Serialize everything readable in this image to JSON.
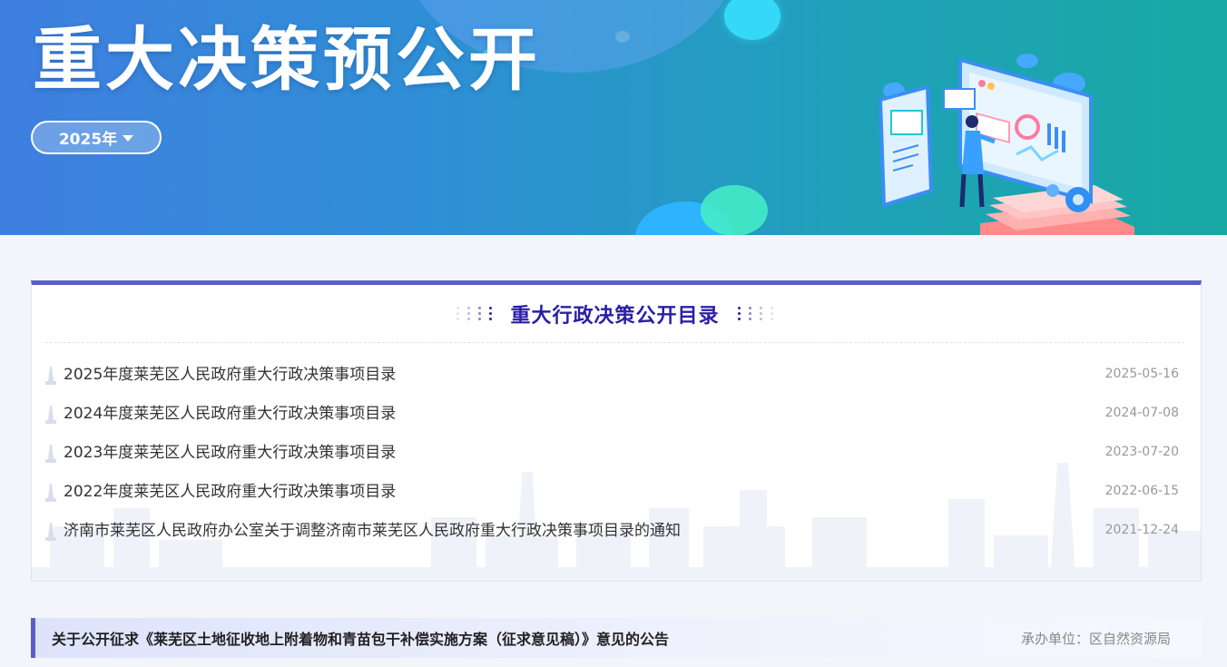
{
  "banner": {
    "title": "重大决策预公开",
    "year_select": "2025年"
  },
  "catalog": {
    "title": "重大行政决策公开目录",
    "items": [
      {
        "title": "2025年度莱芜区人民政府重大行政决策事项目录",
        "date": "2025-05-16"
      },
      {
        "title": "2024年度莱芜区人民政府重大行政决策事项目录",
        "date": "2024-07-08"
      },
      {
        "title": "2023年度莱芜区人民政府重大行政决策事项目录",
        "date": "2023-07-20"
      },
      {
        "title": "2022年度莱芜区人民政府重大行政决策事项目录",
        "date": "2022-06-15"
      },
      {
        "title": "济南市莱芜区人民政府办公室关于调整济南市莱芜区人民政府重大行政决策事项目录的通知",
        "date": "2021-12-24"
      }
    ]
  },
  "notice": {
    "title": "关于公开征求《莱芜区土地征收地上附着物和青苗包干补偿实施方案（征求意见稿）》意见的公告",
    "unit": "承办单位：区自然资源局"
  },
  "colors": {
    "accent": "#5a5ec9",
    "catalog_title": "#2a1fa6",
    "banner_start": "#3f7fe0",
    "banner_end": "#19a9a4"
  }
}
